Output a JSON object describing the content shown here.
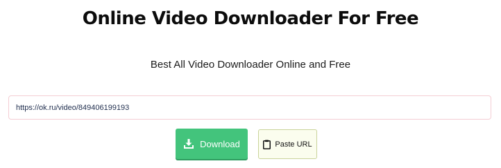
{
  "header": {
    "title": "Online Video Downloader For Free",
    "subtitle": "Best All Video Downloader Online and Free"
  },
  "form": {
    "url_value": "https://ok.ru/video/849406199193",
    "download_label": "Download",
    "download_icon": "download-icon",
    "paste_label": "Paste URL",
    "paste_icon": "clipboard-icon"
  },
  "colors": {
    "download_button": "#43c47c",
    "paste_button": "#fbfdee",
    "input_border": "#f4cdd3"
  }
}
